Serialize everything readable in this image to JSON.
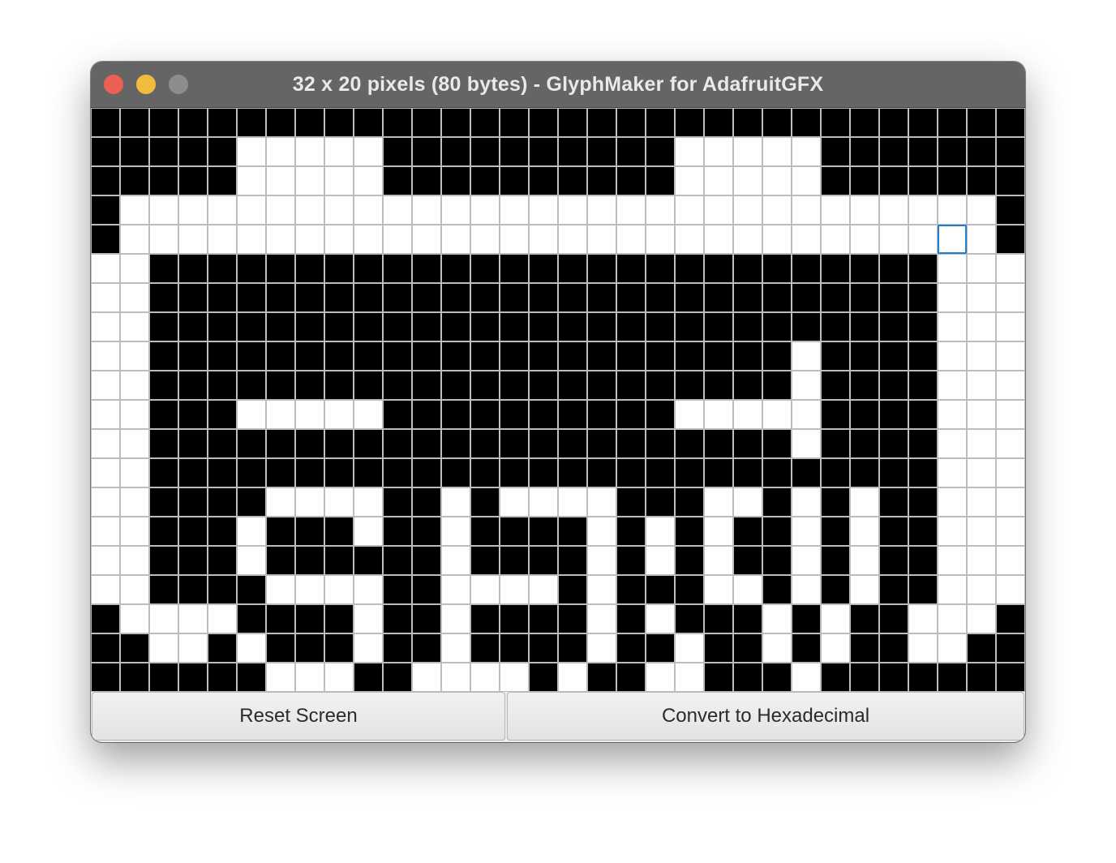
{
  "window": {
    "title": "32 x 20 pixels (80 bytes) - GlyphMaker for AdafruitGFX",
    "traffic_lights": {
      "close_color": "#ec5f55",
      "minimize_color": "#f2bd3f",
      "zoom_color": "#8c8c8c"
    }
  },
  "grid": {
    "columns": 32,
    "rows": 20,
    "on_color": "#000000",
    "off_color": "#ffffff",
    "focused_cell": {
      "row": 4,
      "col": 29
    },
    "pixels": [
      "11111111111111111111111111111111",
      "11111000001111111111000001111111",
      "11111000001111111111000001111111",
      "10000000000000000000000000000001",
      "10000000000000000000000000000001",
      "00111111111111111111111111111000",
      "00111111111111111111111111111000",
      "00111111111111111111111111111000",
      "00111111111111111111111101111000",
      "00111111111111111111111101111000",
      "00111000001111111111000001111000",
      "00111111111111111111111101111000",
      "00111111111111111111111111111000",
      "00111100001101000011100101011000",
      "00111011101101111010101101011000",
      "00111011111101111010101101011000",
      "00111100001100001011100101011000",
      "10000111101101111010111010110001",
      "11001011101101111011011010110011",
      "11111100011000010110011101111111"
    ]
  },
  "buttons": {
    "reset_label": "Reset Screen",
    "convert_label": "Convert to Hexadecimal"
  }
}
